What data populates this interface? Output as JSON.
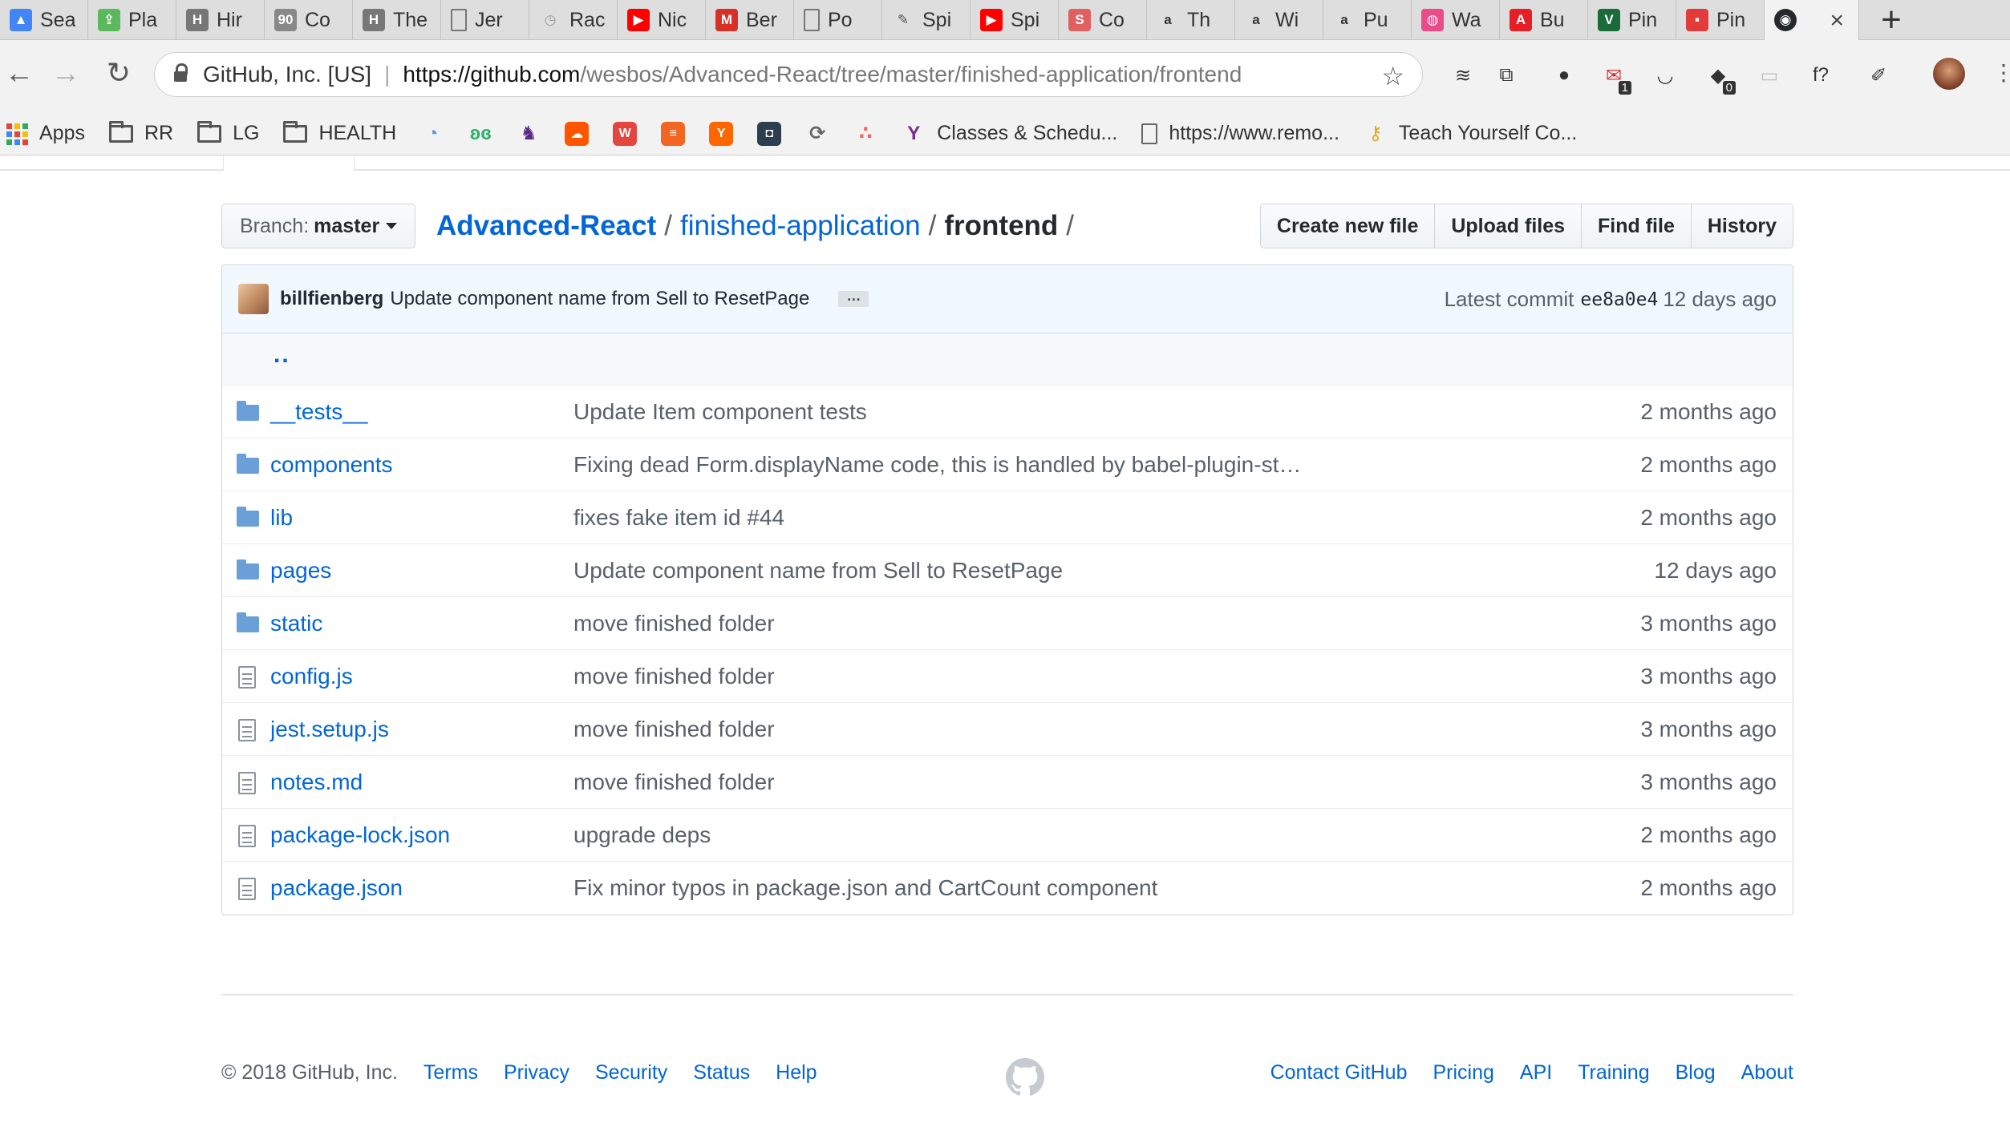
{
  "browser": {
    "tabs": [
      {
        "title": "Sea",
        "icon": "google-drive-icon",
        "color": "#4285f4"
      },
      {
        "title": "Pla",
        "icon": "upload-icon",
        "color": "#5cb85c"
      },
      {
        "title": "Hir",
        "icon": "h-icon",
        "color": "#777777"
      },
      {
        "title": "Co",
        "icon": "90-icon",
        "color": "#888888"
      },
      {
        "title": "The",
        "icon": "h-icon",
        "color": "#777777"
      },
      {
        "title": "Jer",
        "icon": "page-icon",
        "color": "#999999"
      },
      {
        "title": "Rac",
        "icon": "clock-icon",
        "color": "#999999"
      },
      {
        "title": "Nic",
        "icon": "youtube-icon",
        "color": "#ff0000"
      },
      {
        "title": "Ber",
        "icon": "gmail-icon",
        "color": "#d93025"
      },
      {
        "title": "Po",
        "icon": "page-icon",
        "color": "#999999"
      },
      {
        "title": "Spi",
        "icon": "chat-icon",
        "color": "#555555"
      },
      {
        "title": "Spi",
        "icon": "youtube-icon",
        "color": "#ff0000"
      },
      {
        "title": "Co",
        "icon": "s-icon",
        "color": "#e06060"
      },
      {
        "title": "Th",
        "icon": "amazon-icon",
        "color": "#333333"
      },
      {
        "title": "Wi",
        "icon": "amazon-icon",
        "color": "#333333"
      },
      {
        "title": "Pu",
        "icon": "amazon-icon",
        "color": "#333333"
      },
      {
        "title": "Wa",
        "icon": "dribbble-icon",
        "color": "#ea4c89"
      },
      {
        "title": "Bu",
        "icon": "adobe-icon",
        "color": "#e61f26"
      },
      {
        "title": "Pin",
        "icon": "v-icon",
        "color": "#1b6b3a"
      },
      {
        "title": "Pin",
        "icon": "red-icon",
        "color": "#e13b3b"
      }
    ],
    "active_tab": {
      "icon": "github-icon",
      "close": "×"
    },
    "new_tab": "+",
    "omnibox": {
      "site": "GitHub, Inc. [US]",
      "url_host": "https://github.com",
      "url_path": "/wesbos/Advanced-React/tree/master/finished-application/frontend"
    },
    "extensions": [
      {
        "icon": "layers-icon",
        "badge": ""
      },
      {
        "icon": "puzzle-icon",
        "badge": ""
      },
      {
        "icon": "bulb-icon",
        "badge": ""
      },
      {
        "icon": "mail-icon",
        "badge": "1"
      },
      {
        "icon": "pocket-icon",
        "badge": ""
      },
      {
        "icon": "shield-icon",
        "badge": "0"
      },
      {
        "icon": "toggle-icon",
        "badge": ""
      },
      {
        "icon": "fx-icon",
        "badge": ""
      },
      {
        "icon": "eyedropper-icon",
        "badge": ""
      }
    ],
    "bookmarks": [
      {
        "label": "Apps",
        "icon": "apps-grid-icon"
      },
      {
        "label": "RR",
        "icon": "folder-icon"
      },
      {
        "label": "LG",
        "icon": "folder-icon"
      },
      {
        "label": "HEALTH",
        "icon": "folder-icon"
      },
      {
        "label": "",
        "icon": "chart-icon",
        "color": "#5b9bd5"
      },
      {
        "label": "",
        "icon": "butterfly-icon",
        "color": "#2db36b"
      },
      {
        "label": "",
        "icon": "cat-icon",
        "color": "#5b2c83"
      },
      {
        "label": "",
        "icon": "soundcloud-icon",
        "color": "#ff5500"
      },
      {
        "label": "",
        "icon": "w-icon",
        "color": "#e2463f"
      },
      {
        "label": "",
        "icon": "list-icon",
        "color": "#f26522"
      },
      {
        "label": "",
        "icon": "y-icon",
        "color": "#ff6600"
      },
      {
        "label": "",
        "icon": "box-icon",
        "color": "#2c3e50"
      },
      {
        "label": "",
        "icon": "sync-icon",
        "color": "#666666"
      },
      {
        "label": "",
        "icon": "asana-icon",
        "color": "#f06a6a"
      },
      {
        "label": "Classes & Schedu...",
        "icon": "ymca-icon",
        "color": "#7b2b8f"
      },
      {
        "label": "https://www.remo...",
        "icon": "page-icon"
      },
      {
        "label": "Teach Yourself Co...",
        "icon": "key-icon",
        "color": "#e5a823"
      }
    ]
  },
  "repo": {
    "branch_label": "Branch:",
    "branch_value": "master",
    "breadcrumb": {
      "repo": "Advanced-React",
      "folder": "finished-application",
      "current": "frontend",
      "sep": "/"
    },
    "actions": {
      "create": "Create new file",
      "upload": "Upload files",
      "find": "Find file",
      "history": "History"
    },
    "commit": {
      "author": "billfienberg",
      "message": "Update component name from Sell to ResetPage",
      "ellipsis": "…",
      "latest_label": "Latest commit",
      "sha": "ee8a0e4",
      "age": "12 days ago"
    },
    "parent_link": "..",
    "files": [
      {
        "type": "dir",
        "name": "__tests__",
        "message": "Update Item component tests",
        "age": "2 months ago"
      },
      {
        "type": "dir",
        "name": "components",
        "message": "Fixing dead Form.displayName code, this is handled by babel-plugin-st…",
        "age": "2 months ago"
      },
      {
        "type": "dir",
        "name": "lib",
        "message": "fixes fake item id #44",
        "age": "2 months ago"
      },
      {
        "type": "dir",
        "name": "pages",
        "message": "Update component name from Sell to ResetPage",
        "age": "12 days ago"
      },
      {
        "type": "dir",
        "name": "static",
        "message": "move finished folder",
        "age": "3 months ago"
      },
      {
        "type": "file",
        "name": "config.js",
        "message": "move finished folder",
        "age": "3 months ago"
      },
      {
        "type": "file",
        "name": "jest.setup.js",
        "message": "move finished folder",
        "age": "3 months ago"
      },
      {
        "type": "file",
        "name": "notes.md",
        "message": "move finished folder",
        "age": "3 months ago"
      },
      {
        "type": "file",
        "name": "package-lock.json",
        "message": "upgrade deps",
        "age": "2 months ago"
      },
      {
        "type": "file",
        "name": "package.json",
        "message": "Fix minor typos in package.json and CartCount component",
        "age": "2 months ago"
      }
    ]
  },
  "footer": {
    "copyright": "© 2018 GitHub, Inc.",
    "left_links": [
      "Terms",
      "Privacy",
      "Security",
      "Status",
      "Help"
    ],
    "right_links": [
      "Contact GitHub",
      "Pricing",
      "API",
      "Training",
      "Blog",
      "About"
    ],
    "logo_icon": "github-mark-icon"
  },
  "colors": {
    "link": "#0366d6",
    "muted": "#586069",
    "commit_bg": "#f1f8ff",
    "folder": "#6a9fd8"
  }
}
